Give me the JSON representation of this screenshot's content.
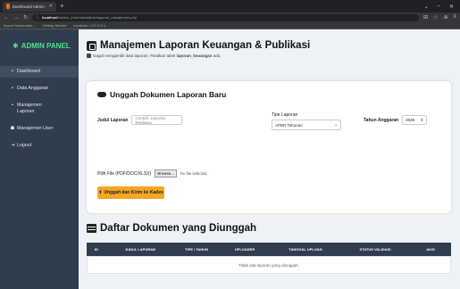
{
  "browser": {
    "tab_title": "Dashboard Admin - Sistem Inf",
    "url_host": "localhost",
    "url_path": "/sistem_informasi/admin/laporan_manajemen.php",
    "bookmarks": [
      "Import bookmarks...",
      "Getting Started",
      "localhost / 127.0.0.1"
    ]
  },
  "sidebar": {
    "brand": "ADMIN PANEL",
    "items": [
      {
        "label": "Dashboard"
      },
      {
        "label": "Data Anggaran"
      },
      {
        "label": "Manajemen Laporan"
      },
      {
        "label": "Manajemen User"
      },
      {
        "label": "Logout"
      }
    ]
  },
  "main": {
    "title": "Manajemen Laporan Keuangan & Publikasi",
    "alert_prefix": "Gagal mengambil data laporan. Pastikan tabel ",
    "alert_table": "laporan_keuangan",
    "alert_suffix": " ada."
  },
  "upload": {
    "title": "Unggah Dokumen Laporan Baru",
    "judul_label": "Judul Laporan",
    "judul_placeholder": "Contoh: Laporan Realisasi",
    "tipe_label": "Tipe Laporan",
    "tipe_value": "APBN Tahunan",
    "tahun_label": "Tahun Anggaran",
    "tahun_value": "2025",
    "file_label": "Pilih File (PDF/DOC/XLSX)",
    "file_button": "Browse...",
    "file_status": "No file selected.",
    "submit_label": "Unggah dan Kirim ke Kades"
  },
  "list": {
    "title": "Daftar Dokumen yang Diunggah",
    "columns": [
      "ID",
      "JUDUL LAPORAN",
      "TIPE / TAHUN",
      "UPLOADER",
      "TANGGAL UPLOAD",
      "STATUS VALIDASI",
      "AKSI"
    ],
    "empty": "Tidak ada laporan yang diunggah."
  }
}
